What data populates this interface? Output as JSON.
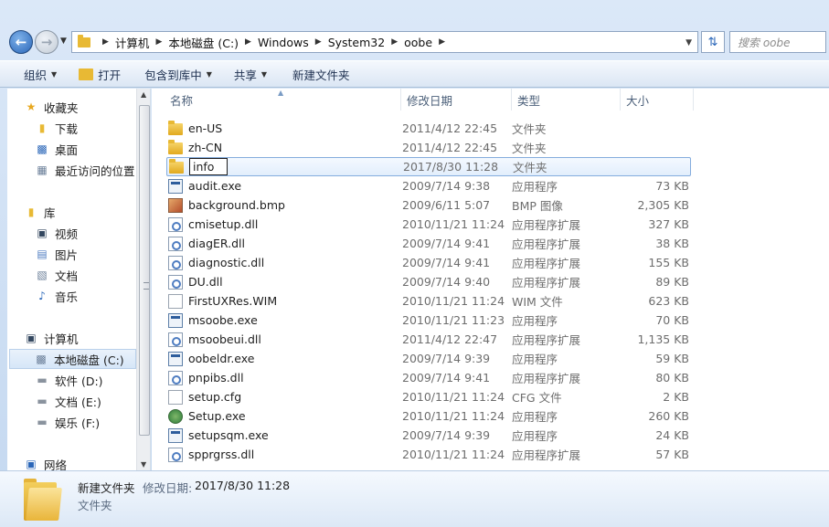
{
  "address": {
    "crumbs": [
      "计算机",
      "本地磁盘 (C:)",
      "Windows",
      "System32",
      "oobe"
    ],
    "search_placeholder": "搜索 oobe"
  },
  "toolbar": {
    "organize": "组织",
    "open": "打开",
    "include_in_library": "包含到库中",
    "share": "共享",
    "new_folder": "新建文件夹"
  },
  "navpane": {
    "favorites": "收藏夹",
    "downloads": "下载",
    "desktop": "桌面",
    "recent": "最近访问的位置",
    "libraries": "库",
    "videos": "视频",
    "pictures": "图片",
    "documents": "文档",
    "music": "音乐",
    "computer": "计算机",
    "drive_c": "本地磁盘 (C:)",
    "drive_d": "软件 (D:)",
    "drive_e": "文档 (E:)",
    "drive_f": "娱乐 (F:)",
    "network": "网络"
  },
  "columns": {
    "name": "名称",
    "date": "修改日期",
    "type": "类型",
    "size": "大小"
  },
  "files": [
    {
      "name": "en-US",
      "date": "2011/4/12 22:45",
      "type": "文件夹",
      "size": "",
      "icon": "folder-icon"
    },
    {
      "name": "zh-CN",
      "date": "2011/4/12 22:45",
      "type": "文件夹",
      "size": "",
      "icon": "folder-icon"
    },
    {
      "name": "info",
      "date": "2017/8/30 11:28",
      "type": "文件夹",
      "size": "",
      "icon": "folder-icon",
      "renaming": true
    },
    {
      "name": "audit.exe",
      "date": "2009/7/14 9:38",
      "type": "应用程序",
      "size": "73 KB",
      "icon": "exe-icon"
    },
    {
      "name": "background.bmp",
      "date": "2009/6/11 5:07",
      "type": "BMP 图像",
      "size": "2,305 KB",
      "icon": "bmp-icon"
    },
    {
      "name": "cmisetup.dll",
      "date": "2010/11/21 11:24",
      "type": "应用程序扩展",
      "size": "327 KB",
      "icon": "dll-icon"
    },
    {
      "name": "diagER.dll",
      "date": "2009/7/14 9:41",
      "type": "应用程序扩展",
      "size": "38 KB",
      "icon": "dll-icon"
    },
    {
      "name": "diagnostic.dll",
      "date": "2009/7/14 9:41",
      "type": "应用程序扩展",
      "size": "155 KB",
      "icon": "dll-icon"
    },
    {
      "name": "DU.dll",
      "date": "2009/7/14 9:40",
      "type": "应用程序扩展",
      "size": "89 KB",
      "icon": "dll-icon"
    },
    {
      "name": "FirstUXRes.WIM",
      "date": "2010/11/21 11:24",
      "type": "WIM 文件",
      "size": "623 KB",
      "icon": "doc-icon"
    },
    {
      "name": "msoobe.exe",
      "date": "2010/11/21 11:23",
      "type": "应用程序",
      "size": "70 KB",
      "icon": "exe-icon"
    },
    {
      "name": "msoobeui.dll",
      "date": "2011/4/12 22:47",
      "type": "应用程序扩展",
      "size": "1,135 KB",
      "icon": "dll-icon"
    },
    {
      "name": "oobeldr.exe",
      "date": "2009/7/14 9:39",
      "type": "应用程序",
      "size": "59 KB",
      "icon": "exe-icon"
    },
    {
      "name": "pnpibs.dll",
      "date": "2009/7/14 9:41",
      "type": "应用程序扩展",
      "size": "80 KB",
      "icon": "dll-icon"
    },
    {
      "name": "setup.cfg",
      "date": "2010/11/21 11:24",
      "type": "CFG 文件",
      "size": "2 KB",
      "icon": "cfg-icon"
    },
    {
      "name": "Setup.exe",
      "date": "2010/11/21 11:24",
      "type": "应用程序",
      "size": "260 KB",
      "icon": "setup-icon"
    },
    {
      "name": "setupsqm.exe",
      "date": "2009/7/14 9:39",
      "type": "应用程序",
      "size": "24 KB",
      "icon": "exe-icon"
    },
    {
      "name": "spprgrss.dll",
      "date": "2010/11/21 11:24",
      "type": "应用程序扩展",
      "size": "57 KB",
      "icon": "dll-icon"
    }
  ],
  "details": {
    "name": "新建文件夹",
    "modified_label": "修改日期:",
    "modified_value": "2017/8/30 11:28",
    "type": "文件夹"
  }
}
